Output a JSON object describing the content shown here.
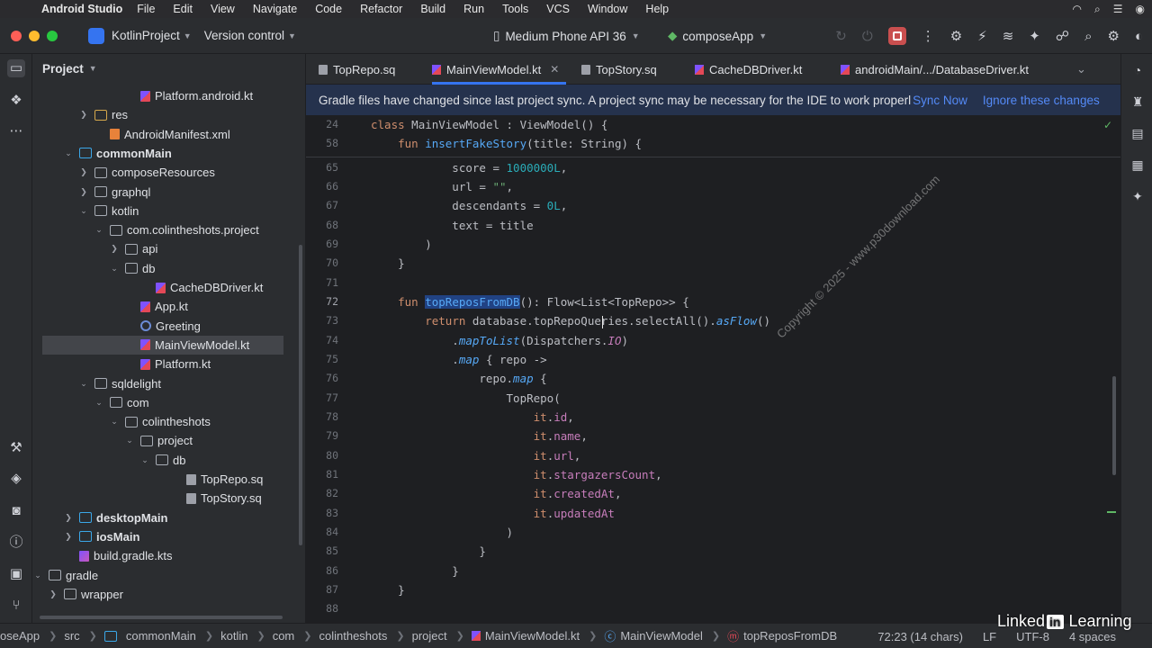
{
  "menubar": {
    "app": "Android Studio",
    "items": [
      "File",
      "Edit",
      "View",
      "Navigate",
      "Code",
      "Refactor",
      "Build",
      "Run",
      "Tools",
      "VCS",
      "Window",
      "Help"
    ]
  },
  "titlebar": {
    "project": "KotlinProject",
    "vcs": "Version control",
    "device": "Medium Phone API 36",
    "config": "composeApp"
  },
  "project_panel": {
    "title": "Project",
    "rows": [
      {
        "label": "Platform.android.kt"
      },
      {
        "label": "res"
      },
      {
        "label": "AndroidManifest.xml"
      },
      {
        "label": "commonMain"
      },
      {
        "label": "composeResources"
      },
      {
        "label": "graphql"
      },
      {
        "label": "kotlin"
      },
      {
        "label": "com.colintheshots.project"
      },
      {
        "label": "api"
      },
      {
        "label": "db"
      },
      {
        "label": "CacheDBDriver.kt"
      },
      {
        "label": "App.kt"
      },
      {
        "label": "Greeting"
      },
      {
        "label": "MainViewModel.kt"
      },
      {
        "label": "Platform.kt"
      },
      {
        "label": "sqldelight"
      },
      {
        "label": "com"
      },
      {
        "label": "colintheshots"
      },
      {
        "label": "project"
      },
      {
        "label": "db"
      },
      {
        "label": "TopRepo.sq"
      },
      {
        "label": "TopStory.sq"
      },
      {
        "label": "desktopMain"
      },
      {
        "label": "iosMain"
      },
      {
        "label": "build.gradle.kts"
      },
      {
        "label": "gradle"
      },
      {
        "label": "wrapper"
      }
    ]
  },
  "tabs": [
    "TopRepo.sq",
    "MainViewModel.kt",
    "TopStory.sq",
    "CacheDBDriver.kt",
    "androidMain/.../DatabaseDriver.kt"
  ],
  "notice": {
    "message": "Gradle files have changed since last project sync. A project sync may be necessary for the IDE to work properl",
    "sync": "Sync Now",
    "ignore": "Ignore these changes"
  },
  "editor": {
    "line_numbers": [
      "24",
      "58",
      "65",
      "66",
      "67",
      "68",
      "69",
      "70",
      "71",
      "72",
      "73",
      "74",
      "75",
      "76",
      "77",
      "78",
      "79",
      "80",
      "81",
      "82",
      "83",
      "84",
      "85",
      "86",
      "87",
      "88"
    ],
    "watermark": "Copyright © 2025 - www.p30download.com"
  },
  "statusbar": {
    "crumbs": [
      "oseApp",
      "src",
      "commonMain",
      "kotlin",
      "com",
      "colintheshots",
      "project",
      "MainViewModel.kt",
      "MainViewModel",
      "topReposFromDB"
    ],
    "position": "72:23 (14 chars)",
    "line_sep": "LF",
    "encoding": "UTF-8",
    "indent": "4 spaces"
  },
  "branding": {
    "linked": "Linked",
    "in": "in",
    "learning": "Learning"
  }
}
